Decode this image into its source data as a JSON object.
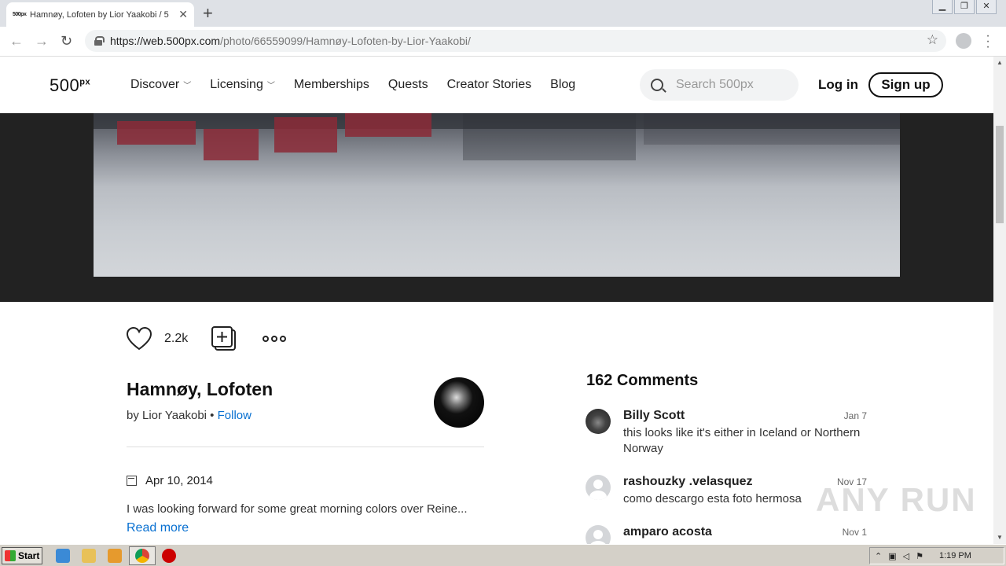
{
  "browser": {
    "tab_favicon": "500px",
    "tab_title": "Hamnøy, Lofoten by Lior Yaakobi / 5",
    "url_host": "https://web.500px.com",
    "url_path": "/photo/66559099/Hamnøy-Lofoten-by-Lior-Yaakobi/"
  },
  "header": {
    "logo": "500",
    "logo_sup": "px",
    "nav": [
      "Discover",
      "Licensing",
      "Memberships",
      "Quests",
      "Creator Stories",
      "Blog"
    ],
    "search_placeholder": "Search 500px",
    "login": "Log in",
    "signup": "Sign up"
  },
  "photo": {
    "like_count": "2.2k",
    "title": "Hamnøy, Lofoten",
    "by_prefix": "by Lior Yaakobi •",
    "follow": "Follow",
    "date": "Apr 10, 2014",
    "description": "I was looking forward for some great morning colors over Reine...",
    "read_more": "Read more"
  },
  "comments": {
    "title": "162 Comments",
    "items": [
      {
        "name": "Billy Scott",
        "date": "Jan 7",
        "text": "this looks like it's either in Iceland or Northern Norway"
      },
      {
        "name": "rashouzky .velasquez",
        "date": "Nov 17",
        "text": "como descargo esta foto hermosa"
      },
      {
        "name": "amparo acosta",
        "date": "Nov 1",
        "text": ""
      }
    ]
  },
  "watermark": "ANY RUN",
  "taskbar": {
    "start": "Start",
    "clock": "1:19 PM"
  }
}
